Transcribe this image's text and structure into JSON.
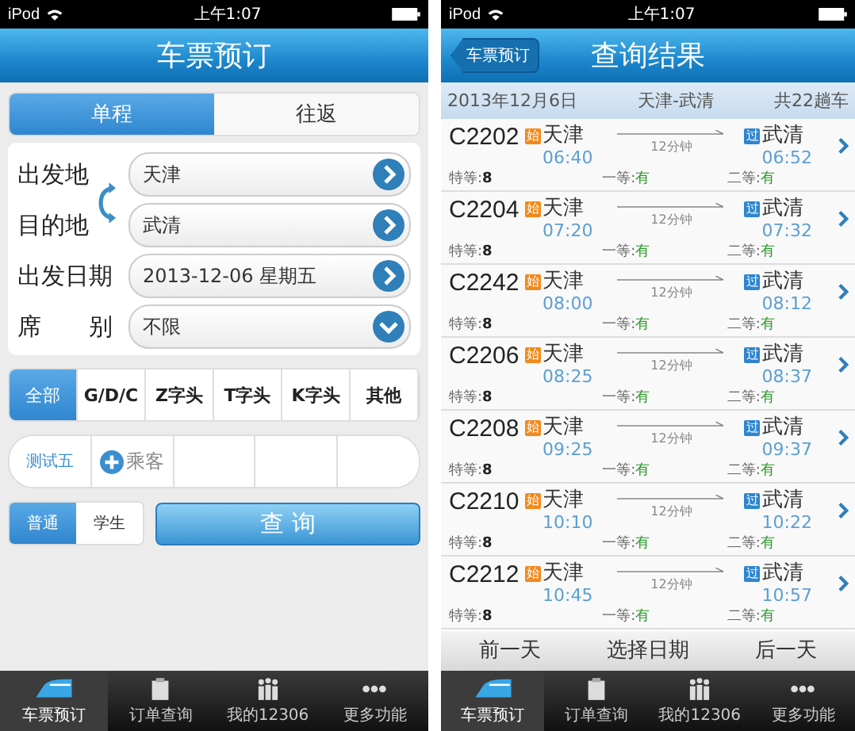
{
  "booking_screen": {
    "status_bar": {
      "carrier": "iPod",
      "time": "上午1:07"
    },
    "title": "车票预订",
    "trip_tabs": [
      {
        "label": "单程",
        "selected": true
      },
      {
        "label": "往返",
        "selected": false
      }
    ],
    "fields": [
      {
        "label": "出发地",
        "value": "天津",
        "kind": "picker"
      },
      {
        "label": "目的地",
        "value": "武清",
        "kind": "picker"
      },
      {
        "label": "出发日期",
        "value": "2013-12-06 星期五",
        "kind": "picker"
      },
      {
        "label": "席　　别",
        "value": "不限",
        "kind": "dropdown"
      }
    ],
    "train_types": [
      {
        "label": "全部",
        "selected": true
      },
      {
        "label": "G/D/C",
        "selected": false
      },
      {
        "label": "Z字头",
        "selected": false
      },
      {
        "label": "T字头",
        "selected": false
      },
      {
        "label": "K字头",
        "selected": false
      },
      {
        "label": "其他",
        "selected": false
      }
    ],
    "passengers": [
      "测试五"
    ],
    "add_passenger": "乘客",
    "ticket_types": [
      {
        "label": "普通",
        "selected": true
      },
      {
        "label": "学生",
        "selected": false
      }
    ],
    "search_button": "查 询",
    "tab_bar": [
      {
        "label": "车票预订",
        "kind": "train",
        "selected": true
      },
      {
        "label": "订单查询",
        "kind": "clipboard",
        "selected": false
      },
      {
        "label": "我的12306",
        "kind": "people",
        "selected": false
      },
      {
        "label": "更多功能",
        "kind": "more",
        "selected": false
      }
    ]
  },
  "results_screen": {
    "status_bar": {
      "carrier": "iPod",
      "time": "上午1:07"
    },
    "back_button": "车票预订",
    "title": "查询结果",
    "summary": {
      "date": "2013年12月6日",
      "route": "天津-武清",
      "count": "共22趟车"
    },
    "trains": [
      {
        "number": "C2202",
        "from_badge": "始",
        "from": "天津",
        "depart": "06:40",
        "duration": "12分钟",
        "to_badge": "过",
        "to": "武清",
        "arrive": "06:52",
        "seats": [
          {
            "label": "特等:",
            "value": "8",
            "kind": "count"
          },
          {
            "label": "一等:",
            "value": "有",
            "kind": "available"
          },
          {
            "label": "二等:",
            "value": "有",
            "kind": "available"
          }
        ]
      },
      {
        "number": "C2204",
        "from_badge": "始",
        "from": "天津",
        "depart": "07:20",
        "duration": "12分钟",
        "to_badge": "过",
        "to": "武清",
        "arrive": "07:32",
        "seats": [
          {
            "label": "特等:",
            "value": "8",
            "kind": "count"
          },
          {
            "label": "一等:",
            "value": "有",
            "kind": "available"
          },
          {
            "label": "二等:",
            "value": "有",
            "kind": "available"
          }
        ]
      },
      {
        "number": "C2242",
        "from_badge": "始",
        "from": "天津",
        "depart": "08:00",
        "duration": "12分钟",
        "to_badge": "过",
        "to": "武清",
        "arrive": "08:12",
        "seats": [
          {
            "label": "特等:",
            "value": "8",
            "kind": "count"
          },
          {
            "label": "一等:",
            "value": "有",
            "kind": "available"
          },
          {
            "label": "二等:",
            "value": "有",
            "kind": "available"
          }
        ]
      },
      {
        "number": "C2206",
        "from_badge": "始",
        "from": "天津",
        "depart": "08:25",
        "duration": "12分钟",
        "to_badge": "过",
        "to": "武清",
        "arrive": "08:37",
        "seats": [
          {
            "label": "特等:",
            "value": "8",
            "kind": "count"
          },
          {
            "label": "一等:",
            "value": "有",
            "kind": "available"
          },
          {
            "label": "二等:",
            "value": "有",
            "kind": "available"
          }
        ]
      },
      {
        "number": "C2208",
        "from_badge": "始",
        "from": "天津",
        "depart": "09:25",
        "duration": "12分钟",
        "to_badge": "过",
        "to": "武清",
        "arrive": "09:37",
        "seats": [
          {
            "label": "特等:",
            "value": "8",
            "kind": "count"
          },
          {
            "label": "一等:",
            "value": "有",
            "kind": "available"
          },
          {
            "label": "二等:",
            "value": "有",
            "kind": "available"
          }
        ]
      },
      {
        "number": "C2210",
        "from_badge": "始",
        "from": "天津",
        "depart": "10:10",
        "duration": "12分钟",
        "to_badge": "过",
        "to": "武清",
        "arrive": "10:22",
        "seats": [
          {
            "label": "特等:",
            "value": "8",
            "kind": "count"
          },
          {
            "label": "一等:",
            "value": "有",
            "kind": "available"
          },
          {
            "label": "二等:",
            "value": "有",
            "kind": "available"
          }
        ]
      },
      {
        "number": "C2212",
        "from_badge": "始",
        "from": "天津",
        "depart": "10:45",
        "duration": "12分钟",
        "to_badge": "过",
        "to": "武清",
        "arrive": "10:57",
        "seats": [
          {
            "label": "特等:",
            "value": "8",
            "kind": "count"
          },
          {
            "label": "一等:",
            "value": "有",
            "kind": "available"
          },
          {
            "label": "二等:",
            "value": "有",
            "kind": "available"
          }
        ]
      }
    ],
    "day_nav": [
      "前一天",
      "选择日期",
      "后一天"
    ],
    "tab_bar": [
      {
        "label": "车票预订",
        "kind": "train",
        "selected": true
      },
      {
        "label": "订单查询",
        "kind": "clipboard",
        "selected": false
      },
      {
        "label": "我的12306",
        "kind": "people",
        "selected": false
      },
      {
        "label": "更多功能",
        "kind": "more",
        "selected": false
      }
    ]
  }
}
